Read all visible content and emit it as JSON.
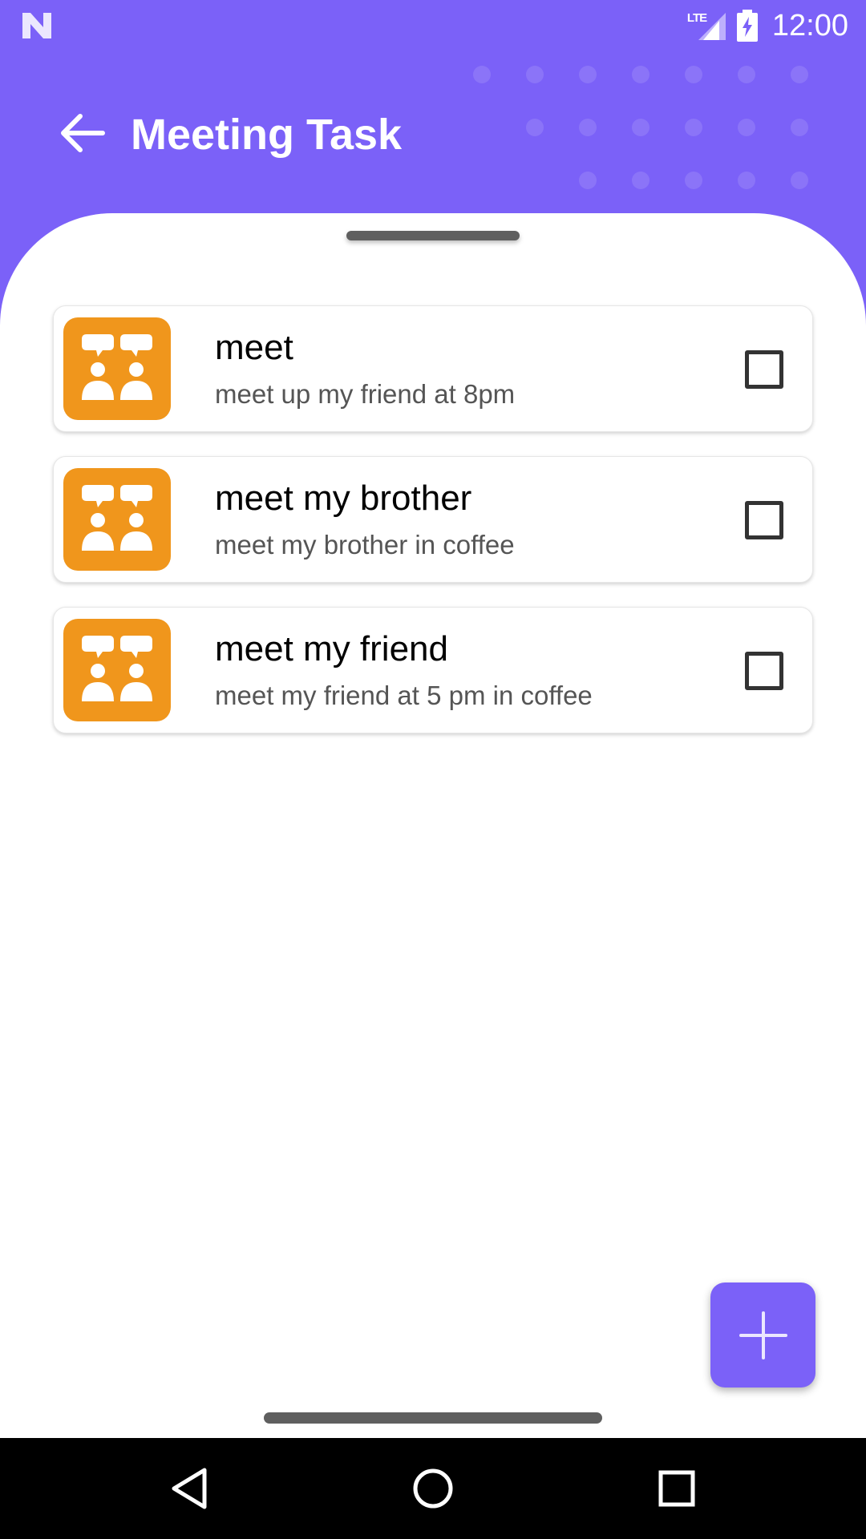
{
  "status_bar": {
    "network": "LTE",
    "time": "12:00",
    "icons": [
      "notification-n-icon",
      "signal-icon",
      "battery-charging-icon"
    ]
  },
  "header": {
    "title": "Meeting Task",
    "back_icon": "arrow-back-icon"
  },
  "tasks": [
    {
      "title": "meet",
      "description": "meet up my friend at 8pm",
      "icon": "meeting-people-icon",
      "checked": false
    },
    {
      "title": "meet my brother",
      "description": "meet my brother in coffee",
      "icon": "meeting-people-icon",
      "checked": false
    },
    {
      "title": "meet my friend",
      "description": "meet my friend at 5 pm in coffee",
      "icon": "meeting-people-icon",
      "checked": false
    }
  ],
  "fab": {
    "icon": "plus-icon"
  },
  "nav": {
    "icons": [
      "nav-back-icon",
      "nav-home-icon",
      "nav-recents-icon"
    ]
  },
  "colors": {
    "primary": "#7B61F8",
    "avatar": "#F0961C",
    "surface": "#FFFFFF",
    "nav_bar": "#000000"
  }
}
